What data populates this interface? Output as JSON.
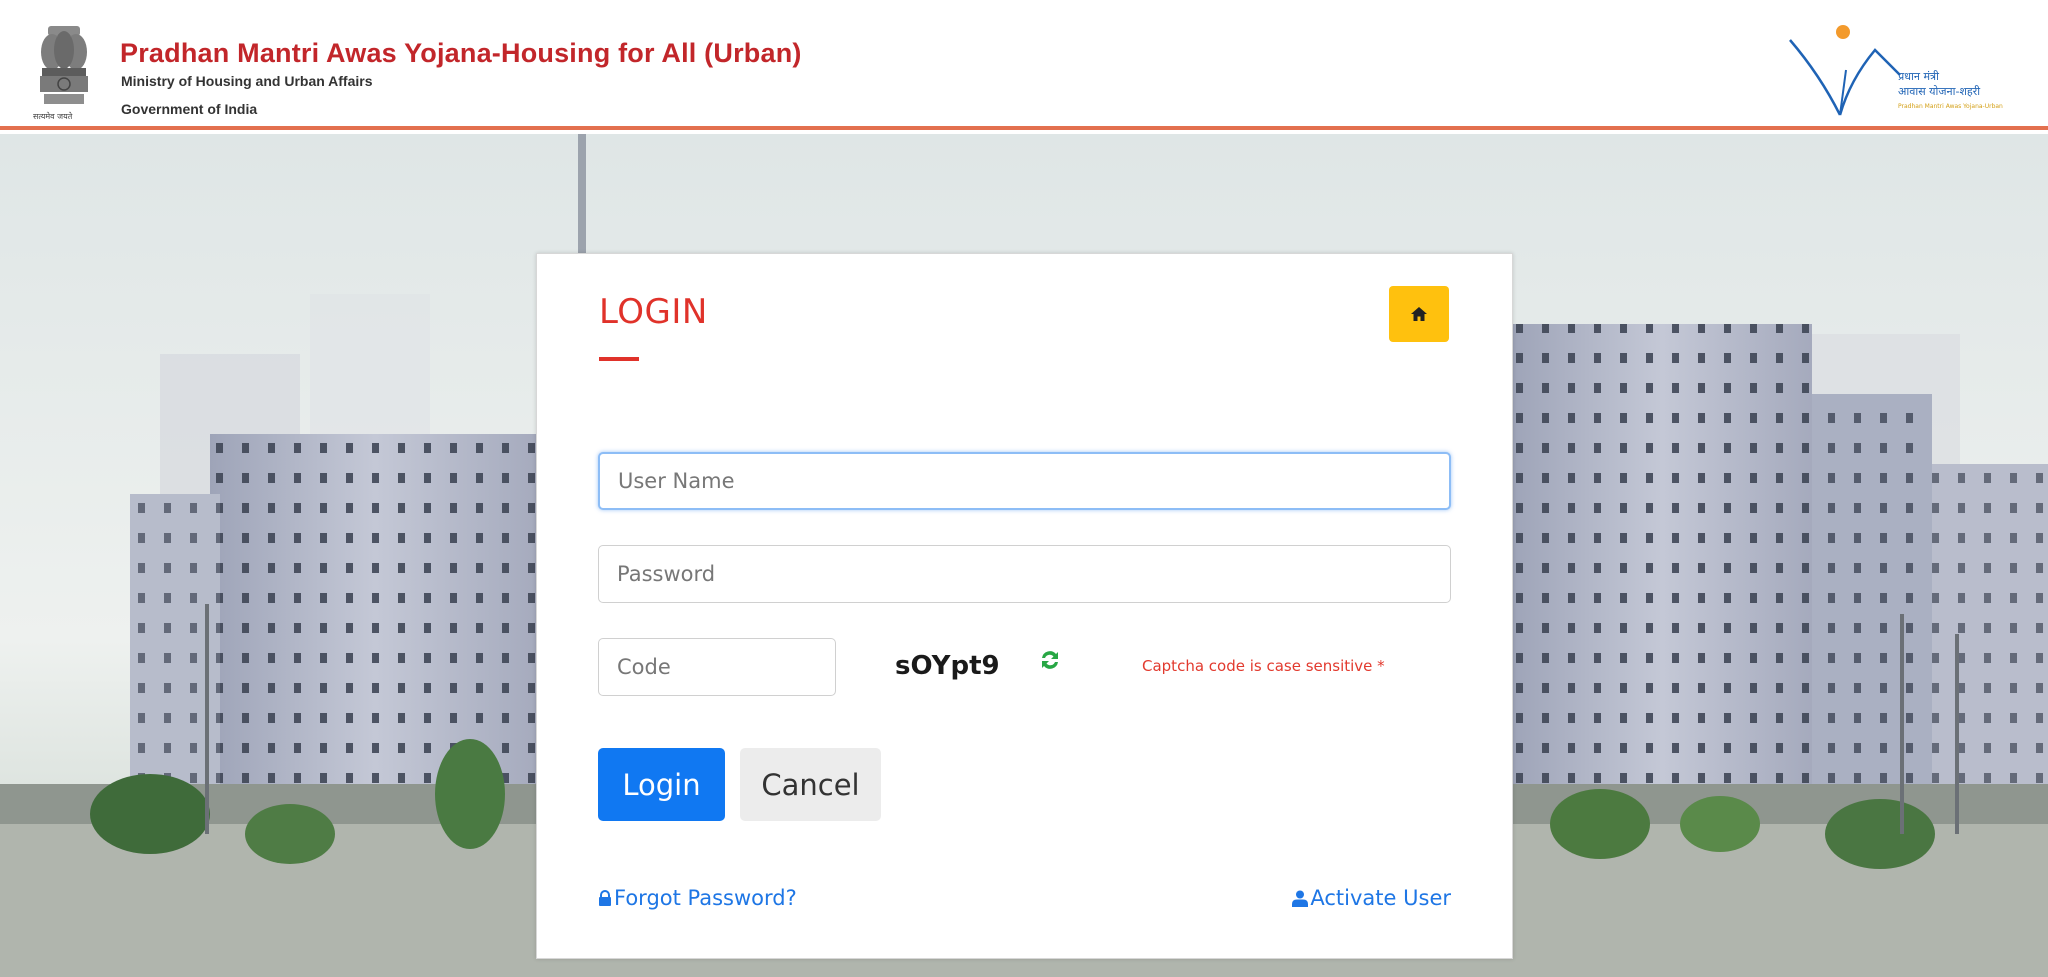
{
  "header": {
    "title": "Pradhan Mantri Awas Yojana-Housing for All (Urban)",
    "ministry": "Ministry of Housing and Urban Affairs",
    "government": "Government of India",
    "emblem_caption": "सत्यमेव जयते",
    "logo_text_line1": "प्रधान मंत्री",
    "logo_text_line2": "आवास योजना-शहरी",
    "logo_text_line3": "Pradhan Mantri Awas Yojana-Urban"
  },
  "login": {
    "heading": "LOGIN",
    "home_icon": "home-icon",
    "username_placeholder": "User Name",
    "password_placeholder": "Password",
    "code_placeholder": "Code",
    "captcha_text": "sOYpt9",
    "refresh_icon": "refresh-icon",
    "captcha_note": "Captcha code is case sensitive *",
    "login_label": "Login",
    "cancel_label": "Cancel",
    "forgot_label": "Forgot Password?",
    "activate_label": "Activate User"
  },
  "colors": {
    "brand_red": "#c2262a",
    "accent_red": "#e0322a",
    "header_rule": "#e3704f",
    "primary_blue": "#1078f2",
    "home_yellow": "#ffc10e",
    "link_blue": "#1e76e5"
  }
}
